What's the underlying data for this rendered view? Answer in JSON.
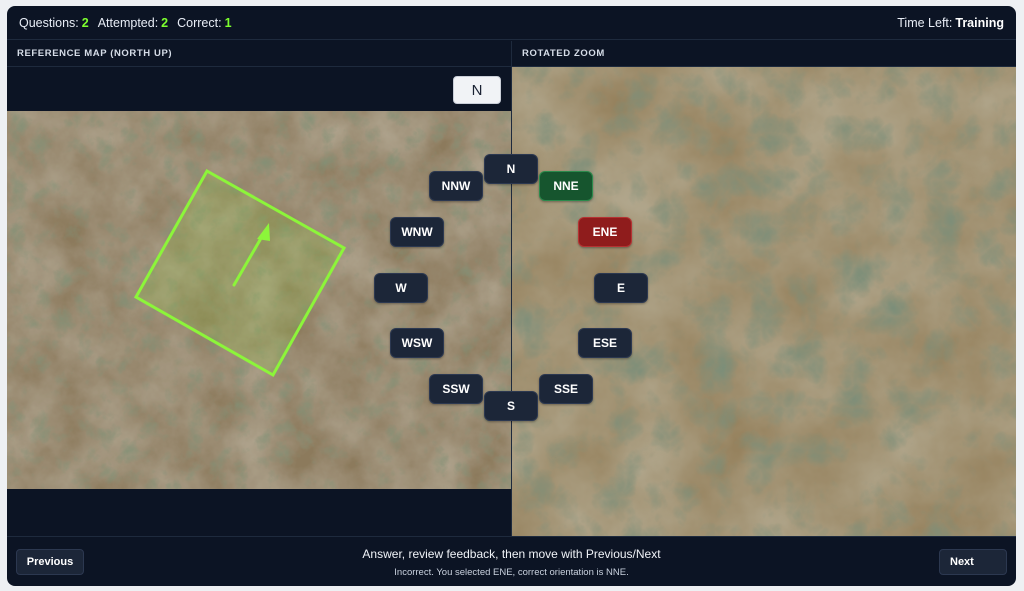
{
  "header": {
    "questions_label": "Questions:",
    "questions_value": "2",
    "attempted_label": "Attempted:",
    "attempted_value": "2",
    "correct_label": "Correct:",
    "correct_value": "1",
    "time_label": "Time Left:",
    "time_value": "Training"
  },
  "panels": {
    "reference_title": "REFERENCE MAP (NORTH UP)",
    "zoom_title": "ROTATED ZOOM",
    "north_badge": "N"
  },
  "compass": {
    "N": "N",
    "NNE": "NNE",
    "ENE": "ENE",
    "E": "E",
    "ESE": "ESE",
    "SSE": "SSE",
    "S": "S",
    "SSW": "SSW",
    "WSW": "WSW",
    "W": "W",
    "WNW": "WNW",
    "NNW": "NNW",
    "correct_choice": "NNE",
    "selected_choice": "ENE"
  },
  "footer": {
    "previous_label": "Previous",
    "next_label": "Next",
    "instructions": "Answer, review feedback, then move with Previous/Next",
    "feedback": "Incorrect. You selected ENE, correct orientation is NNE."
  },
  "colors": {
    "background": "#0c1424",
    "accent_green": "#7dff2e",
    "correct_button": "#16552e",
    "wrong_button": "#8f1c1c",
    "frame_outline": "#8cf53a"
  }
}
